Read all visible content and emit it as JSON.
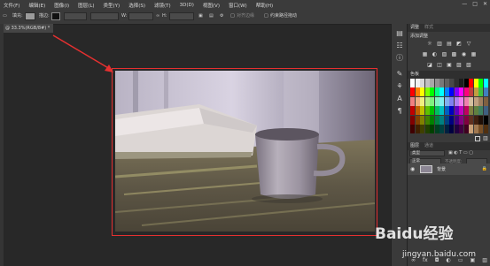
{
  "menu": [
    "文件(F)",
    "编辑(E)",
    "图像(I)",
    "图层(L)",
    "类型(Y)",
    "选择(S)",
    "滤镜(T)",
    "3D(D)",
    "视图(V)",
    "窗口(W)",
    "帮助(H)"
  ],
  "window_controls": [
    "—",
    "□",
    "✕"
  ],
  "options": {
    "fill_label": "填充:",
    "stroke_label": "描边:",
    "w_label": "W:",
    "h_label": "H:",
    "align_edges_label": "对齐边缘",
    "constrain_label": "约束路径拖动"
  },
  "document_tab": "@ 33.3%(RGB/8#) *",
  "panels": {
    "adjust_tabs": [
      "调整",
      "样式"
    ],
    "adjust_title": "添加调整",
    "adjust_rows": [
      [
        "☼",
        "▥",
        "▤",
        "◩",
        "▽"
      ],
      [
        "▦",
        "◐",
        "▧",
        "▩",
        "◉",
        "▦"
      ],
      [
        "◪",
        "◫",
        "▣",
        "▨",
        "▧"
      ]
    ],
    "swatches_tab": "色板",
    "layers_tabs": [
      "图层",
      "通道"
    ],
    "layers_kind_label": "类型",
    "blend_mode": "正常",
    "opacity_label": "不透明度:",
    "lock_label": "锁定:",
    "fill_label": "填充:",
    "layer_name": "背景"
  },
  "colors": {
    "highlight": "#e53030",
    "swatches": [
      "#ffffff",
      "#f0f0f0",
      "#d8d8d8",
      "#c0c0c0",
      "#a8a8a8",
      "#909090",
      "#787878",
      "#606060",
      "#484848",
      "#303030",
      "#1c1c1c",
      "#000000",
      "#ff0000",
      "#ffff00",
      "#00ff00",
      "#00ffff",
      "#ff0000",
      "#ff8000",
      "#ffff00",
      "#80ff00",
      "#00ff00",
      "#00ff80",
      "#00ffff",
      "#0080ff",
      "#0000ff",
      "#8000ff",
      "#ff00ff",
      "#ff0080",
      "#c04040",
      "#c0a040",
      "#40c040",
      "#4080c0",
      "#f08080",
      "#f0b080",
      "#f0f080",
      "#b0f080",
      "#80f080",
      "#80f0c0",
      "#80f0f0",
      "#80b0f0",
      "#8080f0",
      "#b080f0",
      "#f080f0",
      "#f080b0",
      "#d4c0a0",
      "#c0a080",
      "#a08060",
      "#806040",
      "#c00000",
      "#c06000",
      "#c0c000",
      "#60c000",
      "#00c000",
      "#00c060",
      "#00c0c0",
      "#0060c0",
      "#0000c0",
      "#6000c0",
      "#c000c0",
      "#c00060",
      "#808040",
      "#608040",
      "#408060",
      "#406080",
      "#800000",
      "#804000",
      "#808000",
      "#408000",
      "#008000",
      "#008040",
      "#008080",
      "#004080",
      "#000080",
      "#400080",
      "#800080",
      "#800040",
      "#603020",
      "#402010",
      "#201008",
      "#000000",
      "#400000",
      "#402000",
      "#404000",
      "#204000",
      "#004000",
      "#004020",
      "#004040",
      "#002040",
      "#000040",
      "#200040",
      "#400040",
      "#400020",
      "#c8a078",
      "#a07850",
      "#785028",
      "#503010"
    ]
  },
  "watermark": {
    "text": "Baidu经验",
    "url": "jingyan.baidu.com"
  }
}
